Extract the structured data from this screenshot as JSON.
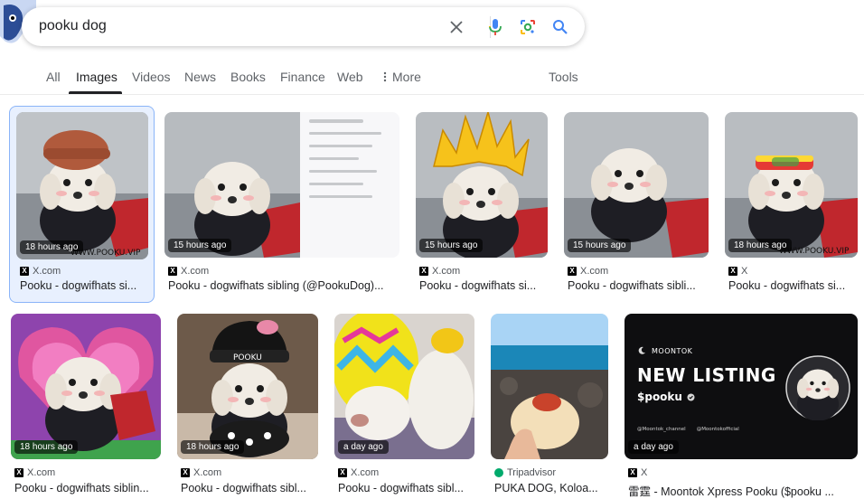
{
  "search": {
    "query": "pooku dog"
  },
  "tabs": [
    {
      "label": "All",
      "active": false
    },
    {
      "label": "Images",
      "active": true
    },
    {
      "label": "Videos",
      "active": false
    },
    {
      "label": "News",
      "active": false
    },
    {
      "label": "Books",
      "active": false
    },
    {
      "label": "Finance",
      "active": false
    },
    {
      "label": "Web",
      "active": false
    },
    {
      "label": "More",
      "active": false
    }
  ],
  "tools_label": "Tools",
  "results": [
    {
      "time": "18 hours ago",
      "source": "X.com",
      "title": "Pooku - dogwifhats si..."
    },
    {
      "time": "15 hours ago",
      "source": "X.com",
      "title": "Pooku - dogwifhats sibling (@PookuDog)..."
    },
    {
      "time": "15 hours ago",
      "source": "X.com",
      "title": "Pooku - dogwifhats si..."
    },
    {
      "time": "15 hours ago",
      "source": "X.com",
      "title": "Pooku - dogwifhats sibli..."
    },
    {
      "time": "18 hours ago",
      "source": "X",
      "title": "Pooku - dogwifhats si..."
    },
    {
      "time": "18 hours ago",
      "source": "X.com",
      "title": "Pooku - dogwifhats siblin..."
    },
    {
      "time": "18 hours ago",
      "source": "X.com",
      "title": "Pooku - dogwifhats sibl..."
    },
    {
      "time": "a day ago",
      "source": "X.com",
      "title": "Pooku - dogwifhats sibl..."
    },
    {
      "time": "",
      "source": "Tripadvisor",
      "title": "PUKA DOG, Koloa..."
    },
    {
      "time": "a day ago",
      "source": "X",
      "title": "雷霆 - Moontok Xpress Pooku ($pooku ..."
    }
  ],
  "listing": {
    "brand": "MOONTOK",
    "headline": "NEW LISTING",
    "ticker": "$pooku",
    "handle1": "@Moontok_channel",
    "handle2": "@Moontokofficial"
  },
  "watermark": "WWW.POOKU.VIP",
  "colors": {
    "accent": "#1a73e8",
    "selected_border": "#8ab4f8",
    "mic_blue": "#4285f4"
  }
}
